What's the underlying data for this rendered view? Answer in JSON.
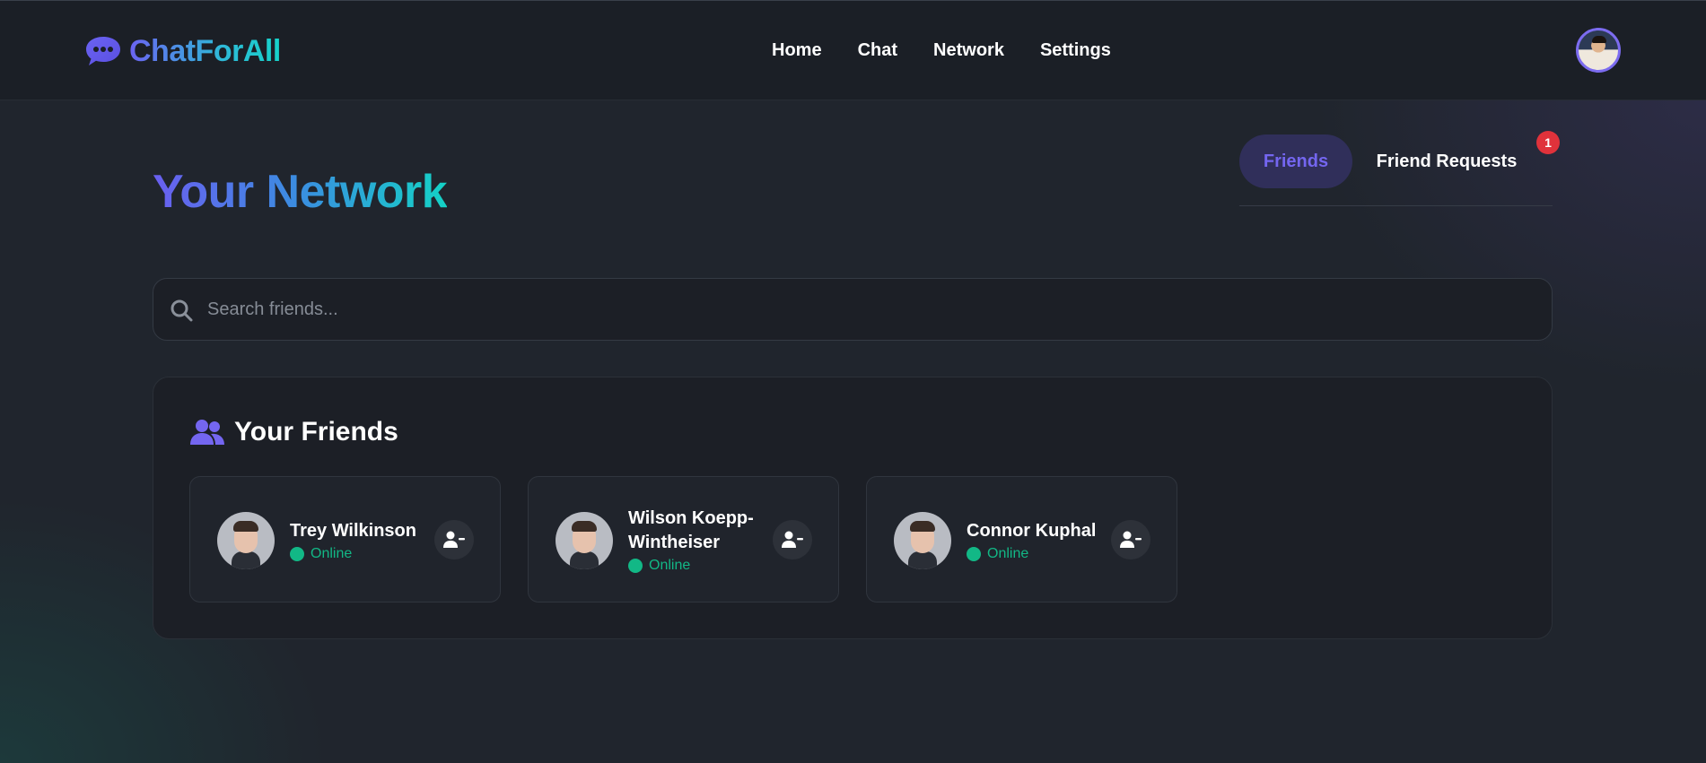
{
  "brand": {
    "name": "ChatForAll",
    "icon": "chat-bubble-icon"
  },
  "nav": {
    "items": [
      {
        "label": "Home"
      },
      {
        "label": "Chat"
      },
      {
        "label": "Network"
      },
      {
        "label": "Settings"
      }
    ]
  },
  "page": {
    "title": "Your Network"
  },
  "tabs": {
    "friends_label": "Friends",
    "requests_label": "Friend Requests",
    "requests_badge": "1",
    "active": "Friends"
  },
  "search": {
    "placeholder": "Search friends...",
    "value": "",
    "icon": "search-icon"
  },
  "friends_panel": {
    "title": "Your Friends",
    "icon": "users-icon",
    "friends": [
      {
        "name": "Trey Wilkinson",
        "status": "Online"
      },
      {
        "name": "Wilson Koepp-Wintheiser",
        "status": "Online"
      },
      {
        "name": "Connor Kuphal",
        "status": "Online"
      }
    ]
  },
  "colors": {
    "accent": "#6c63ff",
    "teal": "#14d2c6",
    "online": "#12b886",
    "badge": "#e0323b",
    "background": "#20252d"
  }
}
